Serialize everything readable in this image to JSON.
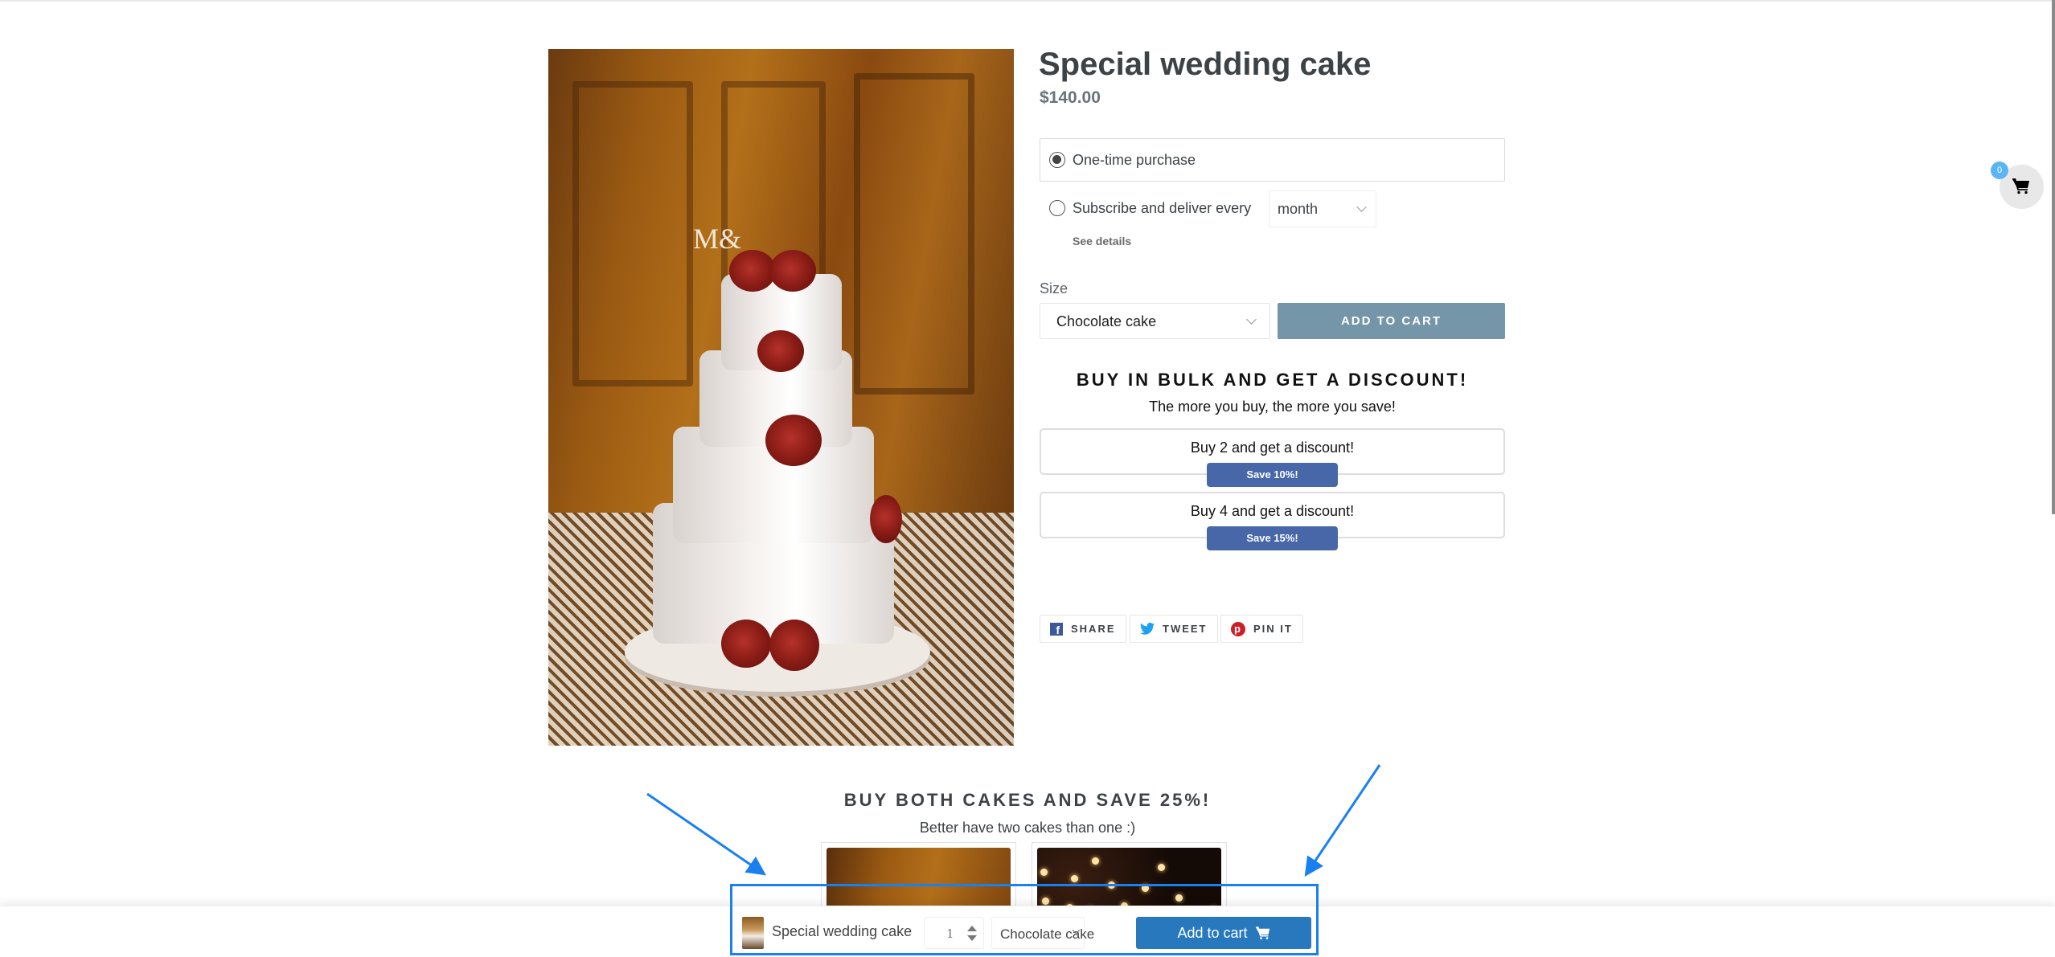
{
  "product": {
    "title": "Special wedding cake",
    "price": "$140.00",
    "image_alt": "Wedding cake with red roses"
  },
  "purchase_options": {
    "one_time_label": "One-time purchase",
    "one_time_selected": true,
    "subscribe_label": "Subscribe and deliver every",
    "subscribe_selected": false,
    "frequency_value": "month",
    "see_details_label": "See details"
  },
  "variant": {
    "label": "Size",
    "selected": "Chocolate cake"
  },
  "add_to_cart_label": "ADD TO CART",
  "bulk_discount": {
    "title": "BUY IN BULK AND GET A DISCOUNT!",
    "subtitle": "The more you buy, the more you save!",
    "tiers": [
      {
        "text": "Buy 2 and get a discount!",
        "badge": "Save 10%!"
      },
      {
        "text": "Buy 4 and get a discount!",
        "badge": "Save 15%!"
      }
    ]
  },
  "share": {
    "facebook_label": "SHARE",
    "twitter_label": "TWEET",
    "pinterest_label": "PIN IT"
  },
  "cart": {
    "count": "0",
    "icon": "cart-icon"
  },
  "bundle": {
    "title": "BUY BOTH CAKES AND SAVE 25%!",
    "subtitle": "Better have two cakes than one :)"
  },
  "sticky_bar": {
    "product_name": "Special wedding cake",
    "quantity": "1",
    "variant": "Chocolate cake",
    "add_to_cart_label": "Add to cart"
  },
  "colors": {
    "add_to_cart_main": "#7496a8",
    "save_badge": "#4767a8",
    "sticky_add_to_cart": "#2878be",
    "annotation": "#1a80f0",
    "cart_badge": "#5bb5f5"
  }
}
